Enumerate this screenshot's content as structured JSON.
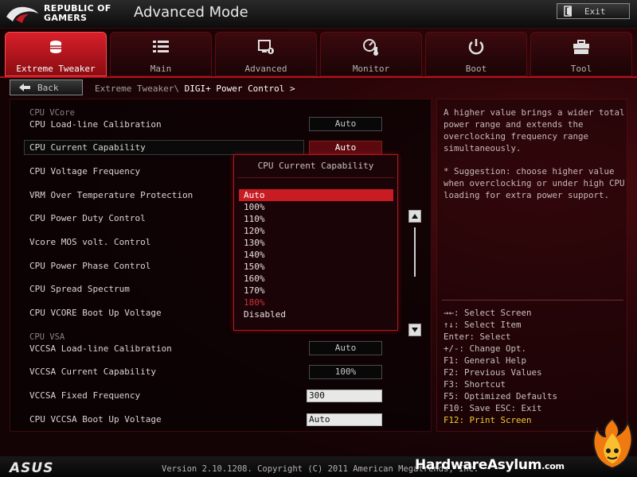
{
  "header": {
    "brand_line1": "REPUBLIC OF",
    "brand_line2": "GAMERS",
    "mode_title": "Advanced Mode",
    "exit_label": "Exit"
  },
  "tabs": [
    {
      "label": "Extreme Tweaker",
      "icon": "extreme-tweaker-icon",
      "active": true
    },
    {
      "label": "Main",
      "icon": "list-icon"
    },
    {
      "label": "Advanced",
      "icon": "advanced-settings-icon"
    },
    {
      "label": "Monitor",
      "icon": "monitor-icon"
    },
    {
      "label": "Boot",
      "icon": "power-icon"
    },
    {
      "label": "Tool",
      "icon": "toolbox-icon"
    }
  ],
  "breadcrumb": {
    "back_label": "Back",
    "path_prefix": "Extreme Tweaker\\ ",
    "current": "DIGI+ Power Control >"
  },
  "settings": {
    "group_vcore": "CPU VCore",
    "group_vsa": "CPU VSA",
    "rows": [
      {
        "label": "CPU Load-line Calibration",
        "value": "Auto"
      },
      {
        "label": "CPU Current Capability",
        "value": "Auto"
      },
      {
        "label": "CPU Voltage Frequency"
      },
      {
        "label": "VRM Over Temperature Protection"
      },
      {
        "label": "CPU Power Duty Control"
      },
      {
        "label": "Vcore MOS volt. Control"
      },
      {
        "label": "CPU Power Phase Control"
      },
      {
        "label": "CPU Spread Spectrum"
      },
      {
        "label": "CPU VCORE Boot Up Voltage"
      },
      {
        "label": "VCCSA Load-line Calibration",
        "value": "Auto"
      },
      {
        "label": "VCCSA Current Capability",
        "value": "100%"
      },
      {
        "label": "VCCSA Fixed Frequency",
        "value": "300"
      },
      {
        "label": "CPU VCCSA Boot Up Voltage",
        "value": "Auto"
      }
    ]
  },
  "popup": {
    "title": "CPU Current Capability",
    "options": [
      "Auto",
      "100%",
      "110%",
      "120%",
      "130%",
      "140%",
      "150%",
      "160%",
      "170%",
      "180%",
      "Disabled"
    ],
    "selected": "Auto"
  },
  "help": {
    "description": [
      "A higher value brings a wider total",
      "power range and extends the",
      "overclocking frequency range",
      "simultaneously."
    ],
    "suggestion": [
      "* Suggestion: choose higher value",
      "when overclocking or under high CPU",
      "loading for extra power support."
    ]
  },
  "keys": [
    "→←: Select Screen",
    "↑↓: Select Item",
    "Enter: Select",
    "+/-: Change Opt.",
    "F1: General Help",
    "F2: Previous Values",
    "F3: Shortcut",
    "F5: Optimized Defaults",
    "F10: Save  ESC: Exit",
    "F12: Print Screen"
  ],
  "footer": {
    "asus_logo": "ASUS",
    "version": "Version 2.10.1208. Copyright (C) 2011 American Megatrends, Inc.",
    "watermark_main": "HardwareAsylum",
    "watermark_suffix": ".com"
  },
  "colors": {
    "accent": "#c81c22",
    "background": "#140305",
    "key_highlight": "#f0d030"
  }
}
